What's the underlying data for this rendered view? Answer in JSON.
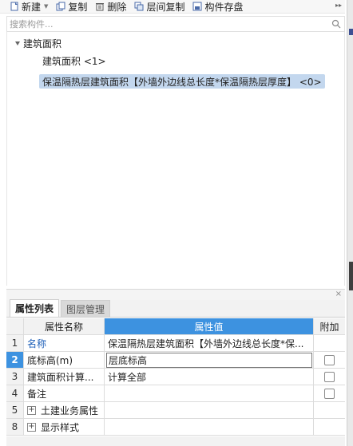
{
  "toolbar": {
    "new_label": "新建",
    "copy_label": "复制",
    "delete_label": "删除",
    "floor_copy_label": "层间复制",
    "save_label": "构件存盘",
    "more_icon": "double-chevron-right"
  },
  "search": {
    "placeholder": "搜索构件..."
  },
  "tree": {
    "root_label": "建筑面积",
    "children": [
      {
        "label": "建筑面积 <1>"
      },
      {
        "label": "保温隔热层建筑面积【外墙外边线总长度*保温隔热层厚度】 <0>",
        "selected": true
      }
    ]
  },
  "panel": {
    "close_glyph": "×",
    "tabs": [
      {
        "label": "属性列表",
        "active": true
      },
      {
        "label": "图层管理",
        "active": false
      }
    ]
  },
  "property_table": {
    "headers": {
      "name": "属性名称",
      "value": "属性值",
      "extra": "附加"
    },
    "rows": [
      {
        "num": "1",
        "name": "名称",
        "value": "保温隔热层建筑面积【外墙外边线总长度*保...",
        "checkbox": false
      },
      {
        "num": "2",
        "name": "底标高(m)",
        "value": "层底标高",
        "checkbox": true
      },
      {
        "num": "3",
        "name": "建筑面积计算...",
        "value": "计算全部",
        "checkbox": true
      },
      {
        "num": "4",
        "name": "备注",
        "value": "",
        "checkbox": true
      },
      {
        "num": "5",
        "name": "土建业务属性",
        "value": "",
        "checkbox": false,
        "expand": "+"
      },
      {
        "num": "8",
        "name": "显示样式",
        "value": "",
        "checkbox": false,
        "expand": "+"
      }
    ]
  },
  "colors": {
    "accent": "#3d92e0",
    "selection": "#c3d7ee",
    "link_text": "#1d5fb8"
  }
}
